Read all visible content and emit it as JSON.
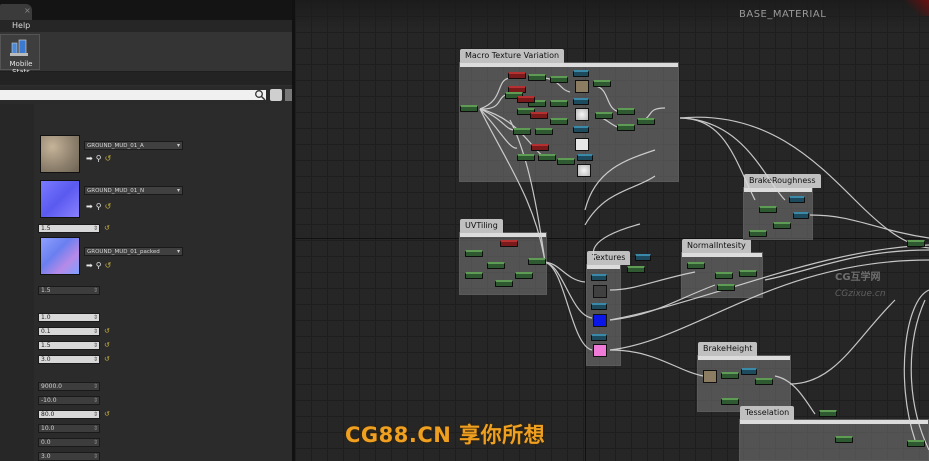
{
  "window": {
    "menu_help": "Help",
    "tab_close": "×"
  },
  "toolbar": {
    "mobile_stats": "Mobile Stats"
  },
  "search": {
    "value": ""
  },
  "textures": [
    {
      "name": "GROUND_MUD_01_A"
    },
    {
      "name": "GROUND_MUD_01_N"
    },
    {
      "name": "GROUND_MUD_01_packed"
    }
  ],
  "values": {
    "v1": "1.5",
    "v2": "1.5",
    "v3": "1.0",
    "v4": "0.1",
    "v5": "1.5",
    "v6": "3.0",
    "v7": "9000.0",
    "v8": "-10.0",
    "v9": "80.0",
    "v10": "10.0",
    "v11": "0.0",
    "v12": "3.0"
  },
  "graph": {
    "title": "BASE_MATERIAL",
    "comments": {
      "macro": "Macro Texture Variation",
      "uvtiling": "UVTiling",
      "textures": "Textures",
      "normal": "NormalIntesity",
      "brake_rough": "BrakeRoughness",
      "brake_height": "BrakeHeight",
      "tesselation": "Tesselation"
    }
  },
  "watermarks": {
    "main": "CG88.CN 享你所想",
    "side": "CG互学网",
    "side2": "CGzixue.cn"
  },
  "colors": {
    "reset": "#c8b040",
    "accent_watermark": "#f0a020",
    "texture_blue": "#0a15e8",
    "texture_pink": "#f07ad8"
  }
}
